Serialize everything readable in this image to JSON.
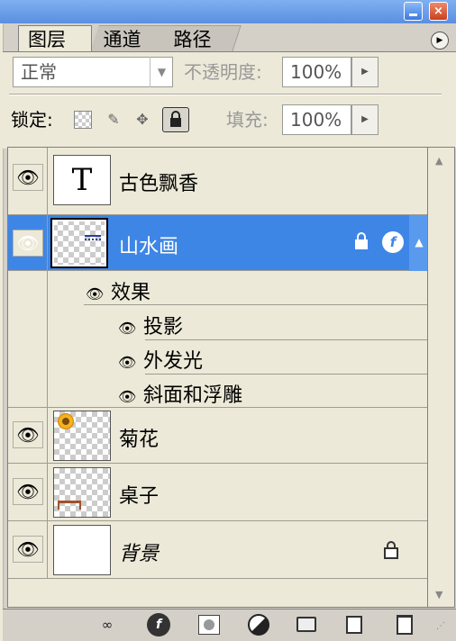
{
  "tabs": {
    "layers": "图层",
    "channels": "通道",
    "paths": "路径"
  },
  "options": {
    "blend_mode": "正常",
    "opacity_label": "不透明度:",
    "opacity_value": "100%",
    "lock_label": "锁定:",
    "fill_label": "填充:",
    "fill_value": "100%"
  },
  "layers": [
    {
      "name": "古色飘香",
      "thumbnail_text": "T",
      "visible": true
    },
    {
      "name": "山水画",
      "visible": true,
      "selected": true,
      "effects_label": "效果",
      "effects": [
        "投影",
        "外发光",
        "斜面和浮雕"
      ]
    },
    {
      "name": "菊花",
      "visible": true
    },
    {
      "name": "桌子",
      "visible": true
    },
    {
      "name": "背景",
      "visible": true,
      "locked": true
    }
  ],
  "icons": {
    "eye": "eye-icon",
    "lock": "lock-icon",
    "fx": "fx-icon",
    "link": "link-icon",
    "mask": "mask-icon",
    "adjustment": "adjustment-icon",
    "folder": "folder-icon",
    "new_layer": "new-layer-icon",
    "trash": "trash-icon"
  },
  "colors": {
    "selection": "#3e86e6",
    "panel": "#ece9d8"
  }
}
